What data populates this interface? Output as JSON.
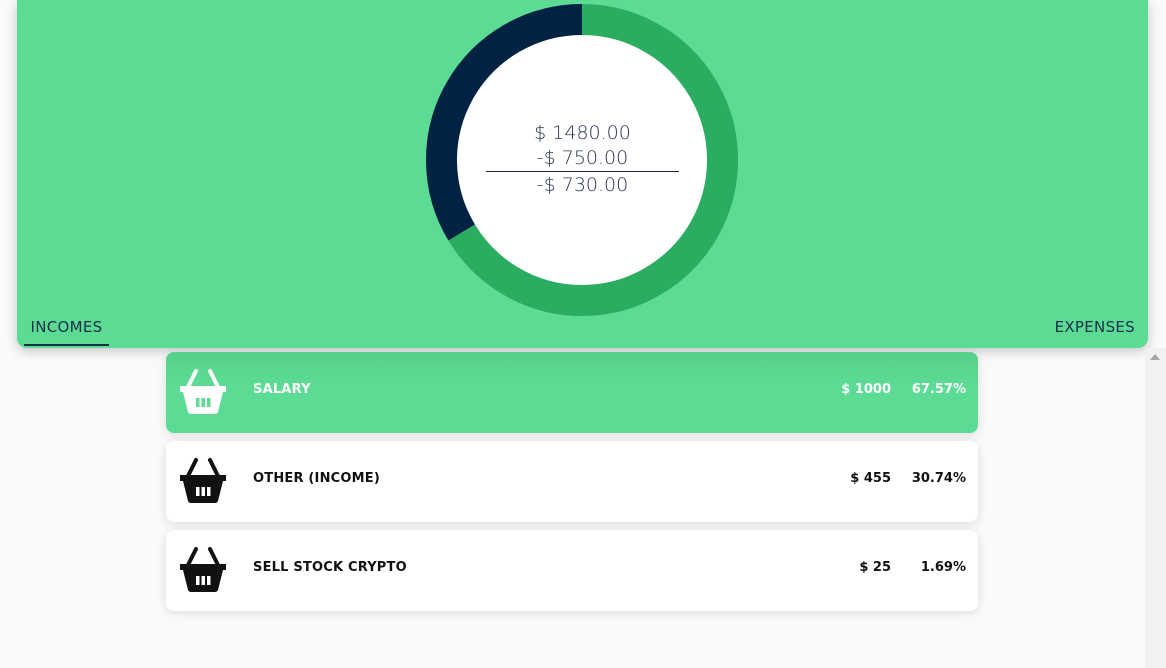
{
  "summary": {
    "incomes_total": "$ 1480.00",
    "expenses_total": "-$ 750.00",
    "balance": "-$ 730.00"
  },
  "chart_data": {
    "type": "pie",
    "categories": [
      "Incomes",
      "Expenses"
    ],
    "values": [
      1480,
      750
    ],
    "colors": [
      "#2aad60",
      "#012242"
    ]
  },
  "tabs": {
    "incomes": "INCOMES",
    "expenses": "EXPENSES",
    "active": "incomes"
  },
  "colors": {
    "header": "#5cdb94",
    "selected_row": "#5cdb94",
    "incomes_ring": "#2aad60",
    "expenses_ring": "#012242"
  },
  "categories": [
    {
      "name": "SALARY",
      "amount": "$ 1000",
      "percent": "67.57%",
      "icon": "basket-icon",
      "selected": true
    },
    {
      "name": "OTHER (INCOME)",
      "amount": "$ 455",
      "percent": "30.74%",
      "icon": "basket-icon",
      "selected": false
    },
    {
      "name": "SELL STOCK CRYPTO",
      "amount": "$ 25",
      "percent": "1.69%",
      "icon": "basket-icon",
      "selected": false
    }
  ]
}
